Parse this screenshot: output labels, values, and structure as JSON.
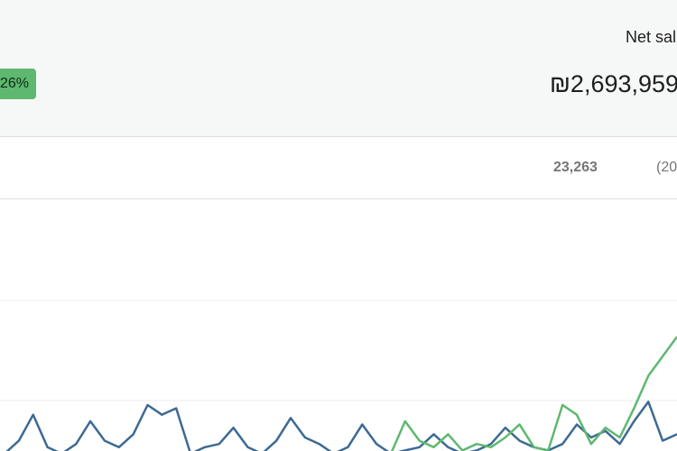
{
  "summary": {
    "change_badge": "26%",
    "stat_label": "Net sal",
    "stat_value": "₪2,693,959"
  },
  "table": {
    "count": "23,263",
    "extra": "(20"
  },
  "chart_data": {
    "type": "line",
    "series": [
      {
        "color": "#3d6a94",
        "values": [
          0,
          4,
          12,
          2,
          0,
          3,
          10,
          4,
          2,
          6,
          15,
          12,
          14,
          0,
          2,
          3,
          8,
          2,
          0,
          4,
          11,
          5,
          3,
          0,
          2,
          9,
          3,
          0,
          1,
          2,
          6,
          2,
          0,
          1,
          3,
          8,
          4,
          2,
          1,
          3,
          9,
          5,
          7,
          3,
          10,
          16,
          4,
          6
        ]
      },
      {
        "color": "#5fb870",
        "values": [
          0,
          0,
          0,
          0,
          0,
          0,
          0,
          0,
          0,
          0,
          0,
          0,
          0,
          0,
          0,
          0,
          0,
          0,
          0,
          0,
          0,
          0,
          0,
          0,
          0,
          0,
          0,
          0,
          10,
          4,
          2,
          6,
          1,
          3,
          2,
          5,
          9,
          2,
          1,
          15,
          12,
          3,
          8,
          5,
          14,
          24,
          30,
          36
        ]
      }
    ]
  }
}
